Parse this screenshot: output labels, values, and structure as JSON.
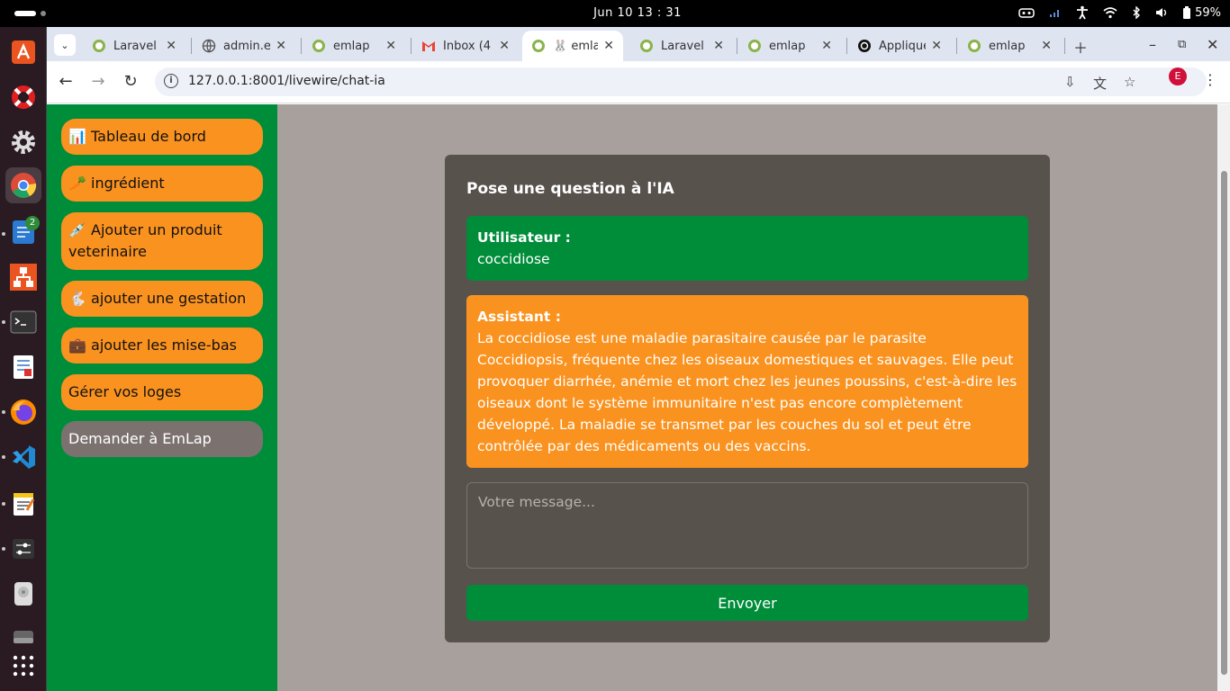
{
  "system": {
    "clock": "Jun 10  13 : 31",
    "battery": "59%"
  },
  "dock": {
    "items": [
      {
        "name": "app-installer-icon",
        "color": "#e95420"
      },
      {
        "name": "lifebuoy-icon",
        "color": "#e02020"
      },
      {
        "name": "settings-gear-icon",
        "color": "#cccccc"
      },
      {
        "name": "chrome-icon",
        "color": "#4285f4"
      },
      {
        "name": "notes-app-icon",
        "color": "#2a7ad2",
        "badge": "2"
      },
      {
        "name": "network-app-icon",
        "color": "#e95420"
      },
      {
        "name": "terminal-icon",
        "color": "#333333"
      },
      {
        "name": "document-viewer-icon",
        "color": "#ffffff"
      },
      {
        "name": "firefox-icon",
        "color": "#ff6611"
      },
      {
        "name": "vscode-icon",
        "color": "#1f8ad2"
      },
      {
        "name": "text-editor-icon",
        "color": "#f5c518"
      },
      {
        "name": "tweaks-icon",
        "color": "#cccccc"
      },
      {
        "name": "disk-utility-icon",
        "color": "#dddddd"
      },
      {
        "name": "drive-icon",
        "color": "#888888"
      },
      {
        "name": "app-grid-icon",
        "color": "#ffffff"
      }
    ]
  },
  "browser": {
    "tabs": [
      {
        "title": "Laravel",
        "icon": "laravel-favicon"
      },
      {
        "title": "admin.e",
        "icon": "globe-favicon"
      },
      {
        "title": "emlap",
        "icon": "laravel-favicon"
      },
      {
        "title": "Inbox (4",
        "icon": "gmail-favicon"
      },
      {
        "title": "🐰 emla",
        "icon": "laravel-favicon",
        "active": true
      },
      {
        "title": "Laravel",
        "icon": "laravel-favicon"
      },
      {
        "title": "emlap",
        "icon": "laravel-favicon"
      },
      {
        "title": "Applique",
        "icon": "openai-favicon"
      },
      {
        "title": "emlap",
        "icon": "laravel-favicon"
      }
    ],
    "url": "127.0.0.1:8001/livewire/chat-ia",
    "profile_initial": "E"
  },
  "sidebar": {
    "items": [
      {
        "label": "📊 Tableau de bord"
      },
      {
        "label": "🥕 ingrédient"
      },
      {
        "label": "💉 Ajouter un produit veterinaire"
      },
      {
        "label": "🐇 ajouter une gestation"
      },
      {
        "label": "💼 ajouter les mise-bas"
      },
      {
        "label": "Gérer vos loges"
      },
      {
        "label": "Demander à EmLap"
      }
    ]
  },
  "chat": {
    "title": "Pose une question à l'IA",
    "messages": [
      {
        "role": "Utilisateur :",
        "text": "coccidiose"
      },
      {
        "role": "Assistant :",
        "text": "La coccidiose est une maladie parasitaire causée par le parasite Coccidiopsis, fréquente chez les oiseaux domestiques et sauvages. Elle peut provoquer diarrhée, anémie et mort chez les jeunes poussins, c'est-à-dire les oiseaux dont le système immunitaire n'est pas encore complètement développé. La maladie se transmet par les couches du sol et peut être contrôlée par des médicaments ou des vaccins."
      }
    ],
    "input_placeholder": "Votre message...",
    "input_value": "",
    "send_label": "Envoyer"
  },
  "colors": {
    "green": "#008d3a",
    "orange": "#fa921f",
    "card": "#58524d",
    "page_bg": "#a8a09c"
  }
}
